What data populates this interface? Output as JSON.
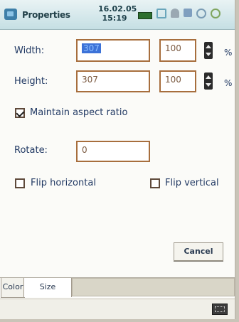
{
  "header": {
    "title": "Properties",
    "date": "16.02.05",
    "time": "15:19",
    "icons": [
      "battery-icon",
      "connection-icon",
      "notification-icon",
      "speaker-icon",
      "sync-icon",
      "ok-icon"
    ]
  },
  "form": {
    "width_label": "Width:",
    "width_value": "307",
    "width_percent": "100",
    "height_label": "Height:",
    "height_value": "307",
    "height_percent": "100",
    "percent_symbol": "%",
    "maintain_aspect_label": "Maintain aspect ratio",
    "maintain_aspect_checked": true,
    "rotate_label": "Rotate:",
    "rotate_value": "0",
    "flip_horizontal_label": "Flip horizontal",
    "flip_horizontal_checked": false,
    "flip_vertical_label": "Flip vertical",
    "flip_vertical_checked": false
  },
  "buttons": {
    "cancel": "Cancel"
  },
  "tabs": [
    {
      "label": "Color",
      "active": false
    },
    {
      "label": "Size",
      "active": true
    }
  ],
  "colors": {
    "accent": "#3c72d8",
    "field_border": "#a76e3d",
    "title_bar": "#c5dfe4"
  }
}
